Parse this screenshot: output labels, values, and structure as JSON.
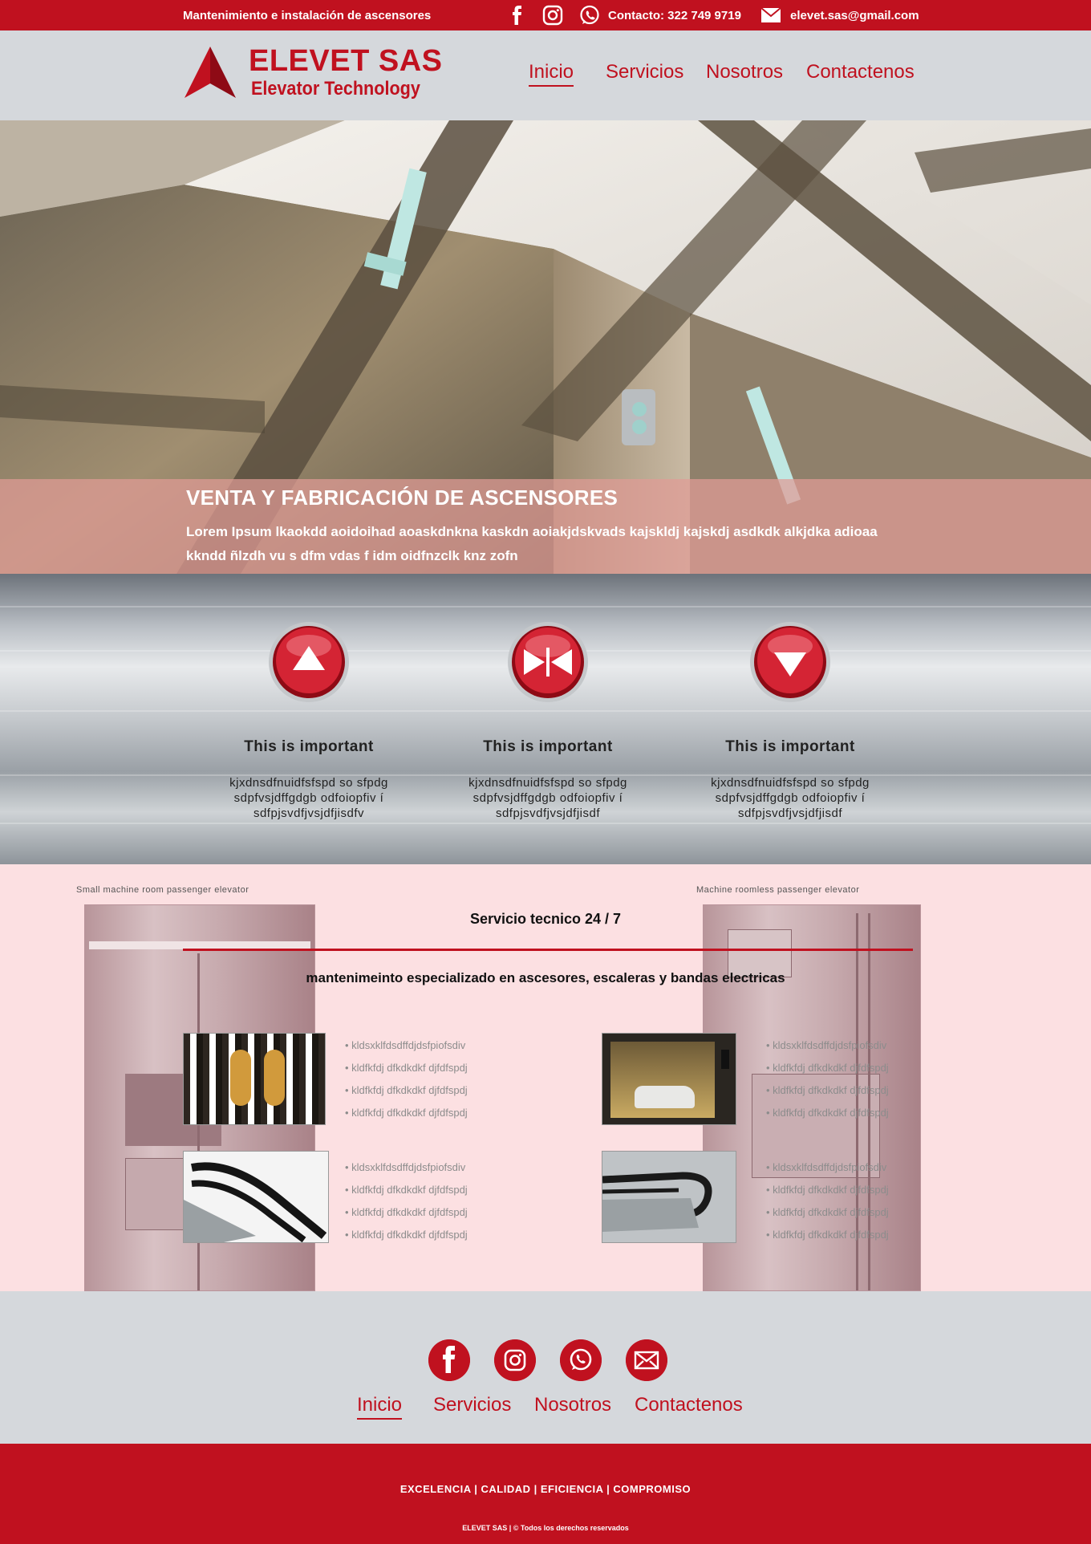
{
  "topbar": {
    "tagline": "Mantenimiento e instalación de ascensores",
    "contact": "Contacto:  322 749 9719",
    "email": "elevet.sas@gmail.com",
    "icons": [
      "facebook-icon",
      "instagram-icon",
      "whatsapp-icon",
      "mail-icon"
    ]
  },
  "header": {
    "logo_name": "ELEVET SAS",
    "logo_sub": "Elevator  Technology",
    "nav": [
      "Inicio",
      "Servicios",
      "Nosotros",
      "Contactenos"
    ],
    "active_nav": "Inicio"
  },
  "hero": {
    "title": "VENTA Y FABRICACIÓN  DE ASCENSORES",
    "body": "Lorem Ipsum lkaokdd aoidoihad aoaskdnkna kaskdn aoiakjdskvads kajskldj kajskdj asdkdk alkjdka adioaa kkndd  ñlzdh vu s dfm vdas f idm oidfnzclk knz zofn"
  },
  "features": [
    {
      "icon": "arrow-up-icon",
      "title": "This is important",
      "text": "kjxdnsdfnuidfsfspd so sfpdg sdpfvsjdffgdgb odfoiopfiv í sdfpjsvdfjvsjdfjisdfv"
    },
    {
      "icon": "doors-close-icon",
      "title": "This is important",
      "text": "kjxdnsdfnuidfsfspd so sfpdg sdpfvsjdffgdgb odfoiopfiv í sdfpjsvdfjvsjdfjisdf"
    },
    {
      "icon": "arrow-down-icon",
      "title": "This is important",
      "text": "kjxdnsdfnuidfsfspd so sfpdg sdpfvsjdffgdgb odfoiopfiv í sdfpjsvdfjvsjdfjisdf"
    }
  ],
  "service": {
    "caption_left": "Small machine room passenger elevator",
    "caption_right": "Machine roomless passenger elevator",
    "title": "Servicio tecnico 24 / 7",
    "subtitle": "mantenimeinto especializado en ascesores, escaleras y bandas electricas",
    "bullets_a": [
      "kldsxklfdsdffdjdsfpiofsdiv",
      "kldfkfdj dfkdkdkf djfdfspdj",
      "kldfkfdj dfkdkdkf djfdfspdj",
      "kldfkfdj dfkdkdkf djfdfspdj"
    ],
    "bullets_b": [
      "kldsxklfdsdffdjdsfpiofsdiv",
      "kldfkfdj dfkdkdkf djfdfspdj",
      "kldfkfdj dfkdkdkf djfdfspdj",
      "kldfkfdj dfkdkdkf djfdfspdj"
    ],
    "bullets_c": [
      "kldsxklfdsdffdjdsfpiofsdiv",
      "kldfkfdj dfkdkdkf djfdfspdj",
      "kldfkfdj dfkdkdkf djfdfspdj",
      "kldfkfdj dfkdkdkf djfdfspdj"
    ],
    "bullets_d": [
      "kldsxklfdsdffdjdsfpiofsdiv",
      "kldfkfdj dfkdkdkf djfdfspdj",
      "kldfkfdj dfkdkdkf djfdfspdj",
      "kldfkfdj dfkdkdkf djfdfspdj"
    ]
  },
  "footer_nav": {
    "icons": [
      "facebook-icon",
      "instagram-icon",
      "whatsapp-icon",
      "mail-icon"
    ],
    "links": [
      "Inicio",
      "Servicios",
      "Nosotros",
      "Contactenos"
    ]
  },
  "footer": {
    "values": "EXCELENCIA   |   CALIDAD   |   EFICIENCIA   |   COMPROMISO",
    "copy": "ELEVET SAS   |   © Todos los derechos reservados"
  },
  "colors": {
    "brand_red": "#c0111f",
    "header_gray": "#d5d8dc",
    "service_pink": "#fce0e2"
  }
}
